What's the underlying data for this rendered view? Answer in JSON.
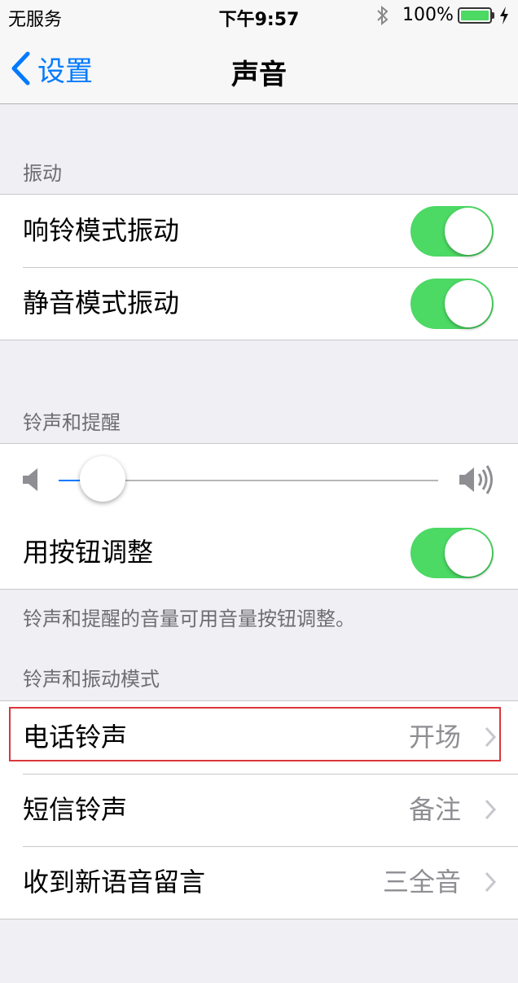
{
  "status_bar": {
    "carrier": "无服务",
    "time": "下午9:57",
    "battery_percent": "100%",
    "bluetooth_icon": "bluetooth-icon",
    "charging_icon": "charging-bolt-icon",
    "battery_level": 1.0
  },
  "nav": {
    "back_label": "设置",
    "title": "声音"
  },
  "vibration": {
    "header": "振动",
    "rows": [
      {
        "label": "响铃模式振动",
        "on": true
      },
      {
        "label": "静音模式振动",
        "on": true
      }
    ]
  },
  "ringer": {
    "header": "铃声和提醒",
    "volume_level": 0.06,
    "change_with_buttons": {
      "label": "用按钮调整",
      "on": true
    },
    "footer": "铃声和提醒的音量可用音量按钮调整。"
  },
  "patterns": {
    "header": "铃声和振动模式",
    "rows": [
      {
        "label": "电话铃声",
        "value": "开场"
      },
      {
        "label": "短信铃声",
        "value": "备注"
      },
      {
        "label": "收到新语音留言",
        "value": "三全音"
      }
    ]
  },
  "colors": {
    "accent": "#007aff",
    "toggle_on": "#4cd964",
    "highlight": "#d9373b",
    "background": "#efeff4"
  }
}
